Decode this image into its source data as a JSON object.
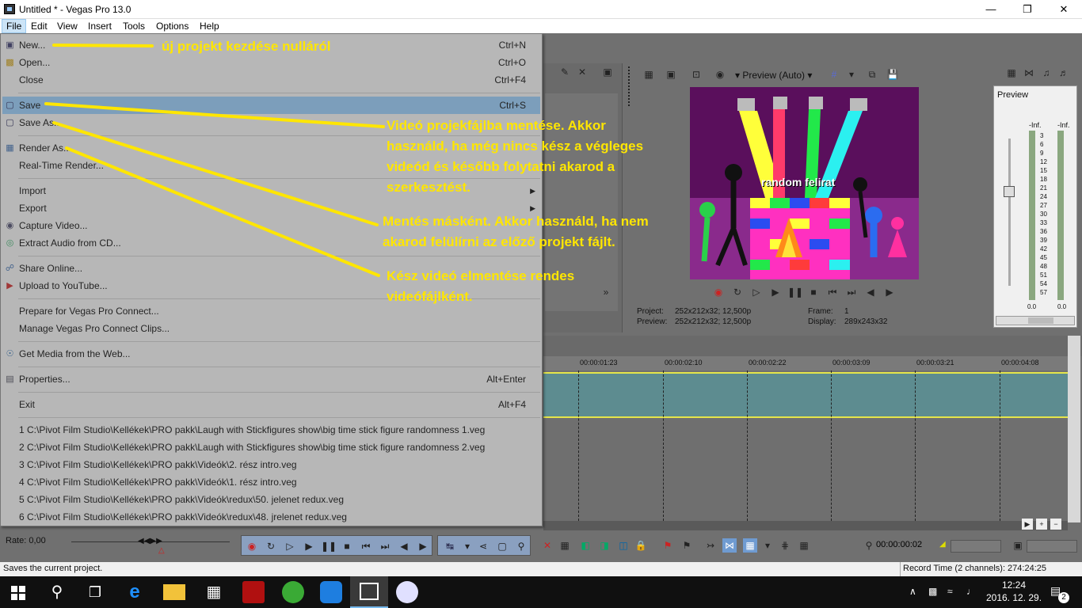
{
  "window": {
    "title": "Untitled * - Vegas Pro 13.0"
  },
  "menubar": [
    "File",
    "Edit",
    "View",
    "Insert",
    "Tools",
    "Options",
    "Help"
  ],
  "file_menu": {
    "items": [
      {
        "label": "New...",
        "shortcut": "Ctrl+N"
      },
      {
        "label": "Open...",
        "shortcut": "Ctrl+O"
      },
      {
        "label": "Close",
        "shortcut": "Ctrl+F4"
      },
      {
        "label": "Save",
        "shortcut": "Ctrl+S"
      },
      {
        "label": "Save As...",
        "shortcut": ""
      },
      {
        "label": "Render As...",
        "shortcut": ""
      },
      {
        "label": "Real-Time Render...",
        "shortcut": ""
      },
      {
        "label": "Import",
        "shortcut": ""
      },
      {
        "label": "Export",
        "shortcut": ""
      },
      {
        "label": "Capture Video...",
        "shortcut": ""
      },
      {
        "label": "Extract Audio from CD...",
        "shortcut": ""
      },
      {
        "label": "Share Online...",
        "shortcut": ""
      },
      {
        "label": "Upload to YouTube...",
        "shortcut": ""
      },
      {
        "label": "Prepare for Vegas Pro Connect...",
        "shortcut": ""
      },
      {
        "label": "Manage Vegas Pro Connect Clips...",
        "shortcut": ""
      },
      {
        "label": "Get Media from the Web...",
        "shortcut": ""
      },
      {
        "label": "Properties...",
        "shortcut": "Alt+Enter"
      },
      {
        "label": "Exit",
        "shortcut": "Alt+F4"
      }
    ],
    "recent": [
      "1 C:\\Pivot Film Studio\\Kellékek\\PRO pakk\\Laugh with Stickfigures show\\big time stick figure randomness 1.veg",
      "2 C:\\Pivot Film Studio\\Kellékek\\PRO pakk\\Laugh with Stickfigures show\\big time stick figure randomness 2.veg",
      "3 C:\\Pivot Film Studio\\Kellékek\\PRO pakk\\Videók\\2. rész intro.veg",
      "4 C:\\Pivot Film Studio\\Kellékek\\PRO pakk\\Videók\\1. rész intro.veg",
      "5 C:\\Pivot Film Studio\\Kellékek\\PRO pakk\\Videók\\redux\\50. jelenet redux.veg",
      "6 C:\\Pivot Film Studio\\Kellékek\\PRO pakk\\Videók\\redux\\48. jrelenet redux.veg"
    ]
  },
  "annotations": {
    "new": "új projekt kezdése nulláról",
    "save": [
      "Videó projekfájlba mentése. Akkor",
      "használd, ha még nincs kész a végleges",
      "videód és később folytatni akarod a",
      "szerkesztést."
    ],
    "save_as": [
      "Mentés másként. Akkor használd, ha nem",
      "akarod felülírni az előző projekt fájlt."
    ],
    "render": [
      "Kész videó elmentése rendes",
      "videófájlként."
    ]
  },
  "preview": {
    "dropdown": "Preview (Auto)",
    "overlay_text": "random felirat",
    "project_label": "Project:",
    "project_value": "252x212x32; 12,500p",
    "preview_label": "Preview:",
    "preview_value": "252x212x32; 12,500p",
    "frame_label": "Frame:",
    "frame_value": "1",
    "display_label": "Display:",
    "display_value": "289x243x32"
  },
  "meter": {
    "title": "Preview",
    "inf_left": "-Inf.",
    "inf_right": "-Inf.",
    "scale": [
      "3",
      "6",
      "9",
      "12",
      "15",
      "18",
      "21",
      "24",
      "27",
      "30",
      "33",
      "36",
      "39",
      "42",
      "45",
      "48",
      "51",
      "54",
      "57"
    ],
    "bottom_left": "0.0",
    "bottom_right": "0.0"
  },
  "timeline": {
    "ticks": [
      "00:00:01:23",
      "00:00:02:10",
      "00:00:02:22",
      "00:00:03:09",
      "00:00:03:21",
      "00:00:04:08"
    ],
    "rate": "Rate: 0,00",
    "timecode": "00:00:00:02"
  },
  "statusbar": {
    "left": "Saves the current project.",
    "right": "Record Time (2 channels): 274:24:25"
  },
  "taskbar": {
    "time": "12:24",
    "date": "2016. 12. 29.",
    "notifications": "2"
  },
  "colors": {
    "annotation": "#ffe600",
    "selection": "#91c9f7",
    "track": "#5d8c90"
  }
}
